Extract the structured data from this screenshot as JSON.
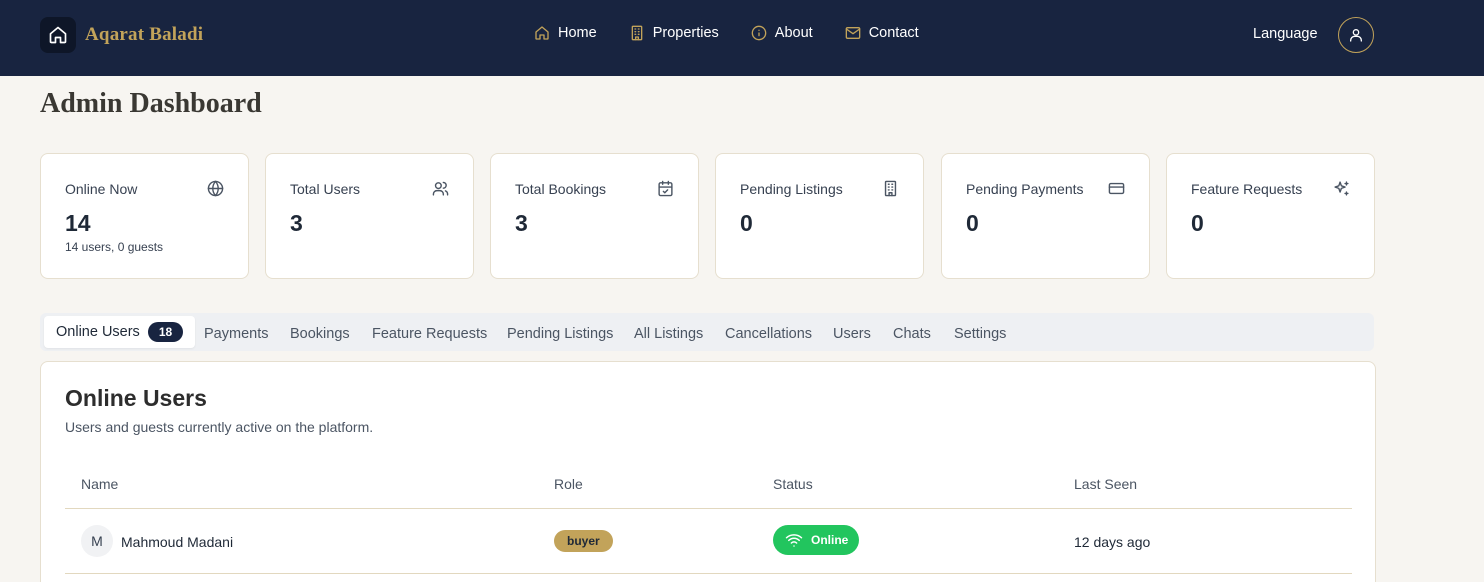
{
  "brand": {
    "name": "Aqarat Baladi",
    "logo_icon": "home-icon"
  },
  "nav": [
    {
      "label": "Home",
      "icon": "home-icon"
    },
    {
      "label": "Properties",
      "icon": "building-icon"
    },
    {
      "label": "About",
      "icon": "info-icon"
    },
    {
      "label": "Contact",
      "icon": "mail-icon"
    }
  ],
  "header": {
    "language_label": "Language",
    "profile_icon": "user-icon"
  },
  "page": {
    "title": "Admin Dashboard"
  },
  "stats": [
    {
      "label": "Online Now",
      "value": "14",
      "sub": "14 users, 0 guests",
      "icon": "globe-icon"
    },
    {
      "label": "Total Users",
      "value": "3",
      "sub": "",
      "icon": "users-icon"
    },
    {
      "label": "Total Bookings",
      "value": "3",
      "sub": "",
      "icon": "calendar-check-icon"
    },
    {
      "label": "Pending Listings",
      "value": "0",
      "sub": "",
      "icon": "building-icon"
    },
    {
      "label": "Pending Payments",
      "value": "0",
      "sub": "",
      "icon": "credit-card-icon"
    },
    {
      "label": "Feature Requests",
      "value": "0",
      "sub": "",
      "icon": "sparkles-icon"
    }
  ],
  "tabs": [
    {
      "label": "Online Users",
      "badge": "18",
      "active": true
    },
    {
      "label": "Payments"
    },
    {
      "label": "Bookings"
    },
    {
      "label": "Feature Requests"
    },
    {
      "label": "Pending Listings"
    },
    {
      "label": "All Listings"
    },
    {
      "label": "Cancellations"
    },
    {
      "label": "Users"
    },
    {
      "label": "Chats"
    },
    {
      "label": "Settings"
    }
  ],
  "online_users": {
    "title": "Online Users",
    "subtitle": "Users and guests currently active on the platform.",
    "columns": [
      "Name",
      "Role",
      "Status",
      "Last Seen"
    ],
    "rows": [
      {
        "initial": "M",
        "name": "Mahmoud Madani",
        "role": "buyer",
        "status": "Online",
        "last_seen": "12 days ago"
      }
    ]
  },
  "colors": {
    "header_bg": "#182440",
    "accent_gold": "#c2a35a",
    "online_green": "#22c55e",
    "page_bg": "#f7f5f1"
  }
}
